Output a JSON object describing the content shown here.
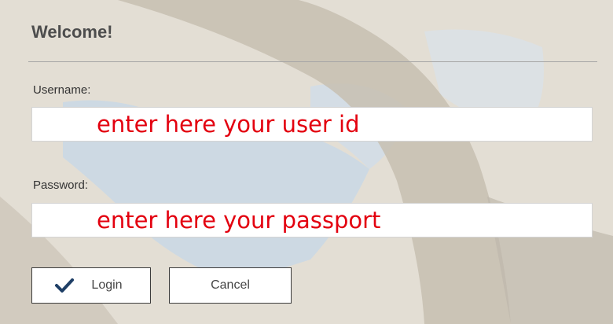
{
  "dialog": {
    "title": "Welcome!"
  },
  "username": {
    "label": "Username:",
    "hint": "enter here your user id"
  },
  "password": {
    "label": "Password:",
    "hint": "enter here your passport"
  },
  "actions": {
    "login_label": "Login",
    "cancel_label": "Cancel"
  },
  "colors": {
    "hint_text": "#e3000f",
    "check_icon": "#1f3f66"
  }
}
